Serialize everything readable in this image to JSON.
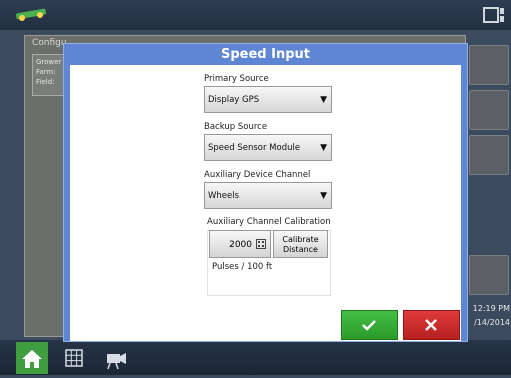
{
  "background": {
    "config_label": "Configu",
    "grower_lines": [
      "Grower",
      "Farm:",
      "Field:"
    ],
    "clock_time": "12:19 PM",
    "clock_date": "/14/2014"
  },
  "dialog": {
    "title": "Speed Input",
    "primary_source": {
      "label": "Primary Source",
      "value": "Display GPS"
    },
    "backup_source": {
      "label": "Backup Source",
      "value": "Speed Sensor Module"
    },
    "aux_channel": {
      "label": "Auxiliary Device Channel",
      "value": "Wheels"
    },
    "calibration": {
      "label": "Auxiliary Channel Calibration",
      "value": "2000",
      "button_label_1": "Calibrate",
      "button_label_2": "Distance",
      "units": "Pulses / 100 ft"
    }
  },
  "icons": {
    "logo": "tractor-logo-icon",
    "window": "window-switch-icon",
    "home": "home-icon",
    "grid": "grid-icon",
    "camera": "camera-icon",
    "dropdown": "chevron-down-icon",
    "keyboard": "keypad-icon",
    "ok": "checkmark-icon",
    "cancel": "close-icon"
  },
  "colors": {
    "dialog_frame": "#5f86d2",
    "ok": "#3aaa3a",
    "cancel": "#cc2a2a",
    "home": "#3f9e3f"
  }
}
